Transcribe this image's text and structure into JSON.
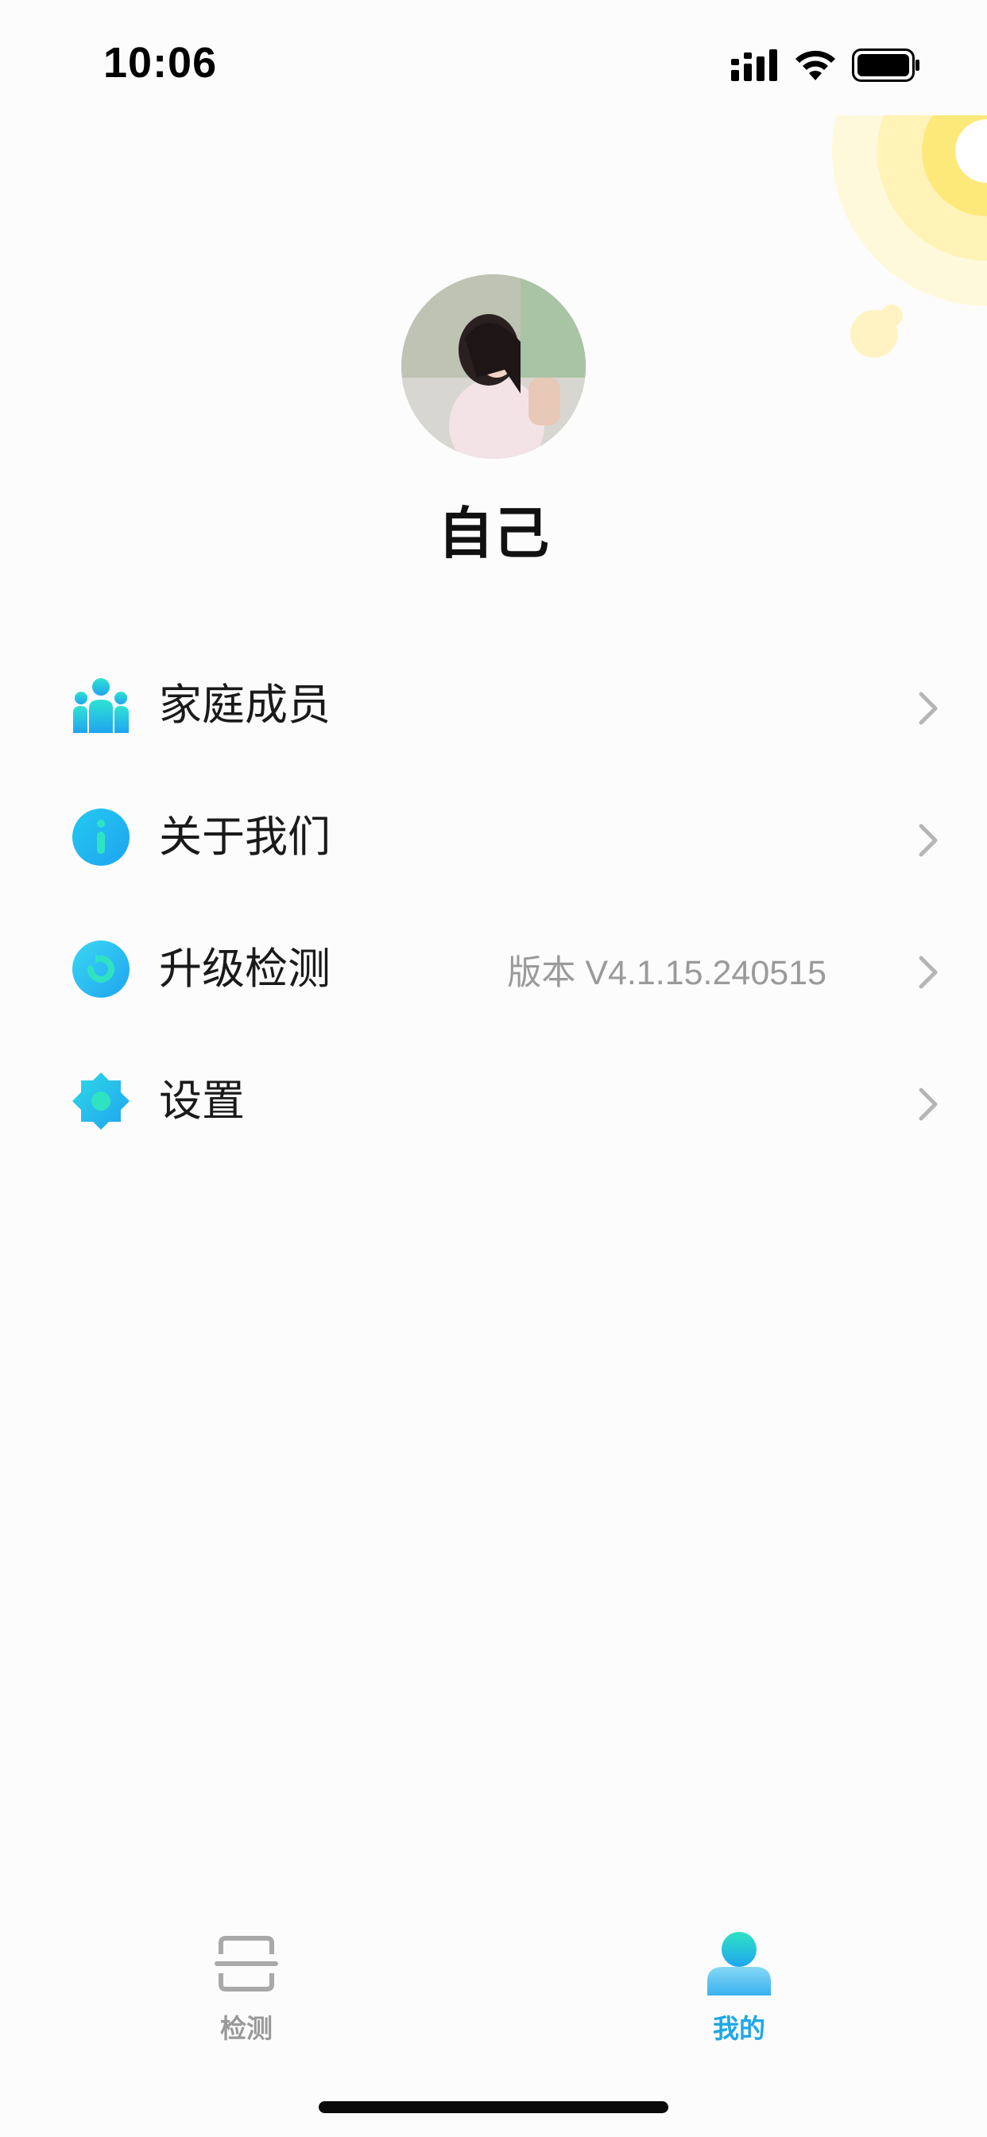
{
  "status_bar": {
    "time": "10:06"
  },
  "profile": {
    "name": "自己"
  },
  "menu": {
    "items": [
      {
        "label": "家庭成员",
        "icon": "family-members-icon",
        "extra": ""
      },
      {
        "label": "关于我们",
        "icon": "info-icon",
        "extra": ""
      },
      {
        "label": "升级检测",
        "icon": "update-check-icon",
        "extra": "版本 V4.1.15.240515"
      },
      {
        "label": "设置",
        "icon": "settings-gear-icon",
        "extra": ""
      }
    ]
  },
  "tab_bar": {
    "tabs": [
      {
        "label": "检测",
        "icon": "scan-icon",
        "active": false
      },
      {
        "label": "我的",
        "icon": "profile-person-icon",
        "active": true
      }
    ]
  },
  "colors": {
    "accent": "#1fa7e6",
    "icon_gradient_start": "#2fe3d2",
    "icon_gradient_end": "#1fa4f0",
    "inactive_tab": "#999999",
    "deco_yellow": "#fde97a"
  }
}
